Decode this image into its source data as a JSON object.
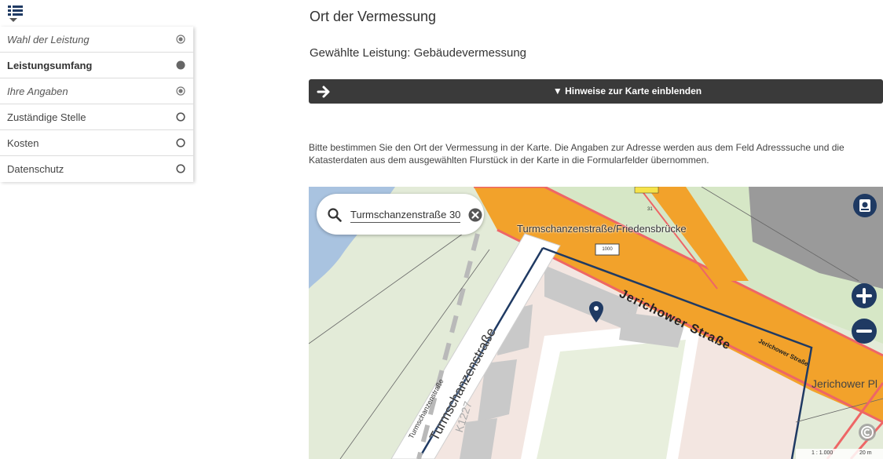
{
  "sidebar": {
    "steps": [
      {
        "label": "Wahl der Leistung",
        "state": "done"
      },
      {
        "label": "Leistungsumfang",
        "state": "current"
      },
      {
        "label": "Ihre Angaben",
        "state": "done"
      },
      {
        "label": "Zuständige Stelle",
        "state": "open"
      },
      {
        "label": "Kosten",
        "state": "open"
      },
      {
        "label": "Datenschutz",
        "state": "open"
      }
    ]
  },
  "main": {
    "title": "Ort der Vermessung",
    "service_line": "Gewählte Leistung: Gebäudevermessung",
    "hint_toggle": "▼ Hinweise zur Karte einblenden",
    "instructions": "Bitte bestimmen Sie den Ort der Vermessung in der Karte. Die Angaben zur Adresse werden aus dem Feld Adresssuche und die Katasterdaten aus dem ausgewählten Flurstück in der Karte in die Formularfelder übernommen."
  },
  "map": {
    "search": {
      "value": "Turmschanzenstraße 30"
    },
    "labels": {
      "bridge": "Turmschanzenstraße/Friedensbrücke",
      "street_main": "Jerichower Straße",
      "street_small": "Jerichower Straße",
      "street_left": "Turmschanzenstraße",
      "street_bottom": "Turmschanzenstraße",
      "road_id": "K1227",
      "right_cut": "Jerichower Pl",
      "housenum": "1000",
      "house_31": "31"
    },
    "scale": {
      "ratio": "1 : 1.000",
      "distance": "20 m"
    },
    "colors": {
      "road": "#f2a22b",
      "accent": "#1f3a63",
      "water": "#a9c3e0"
    }
  }
}
